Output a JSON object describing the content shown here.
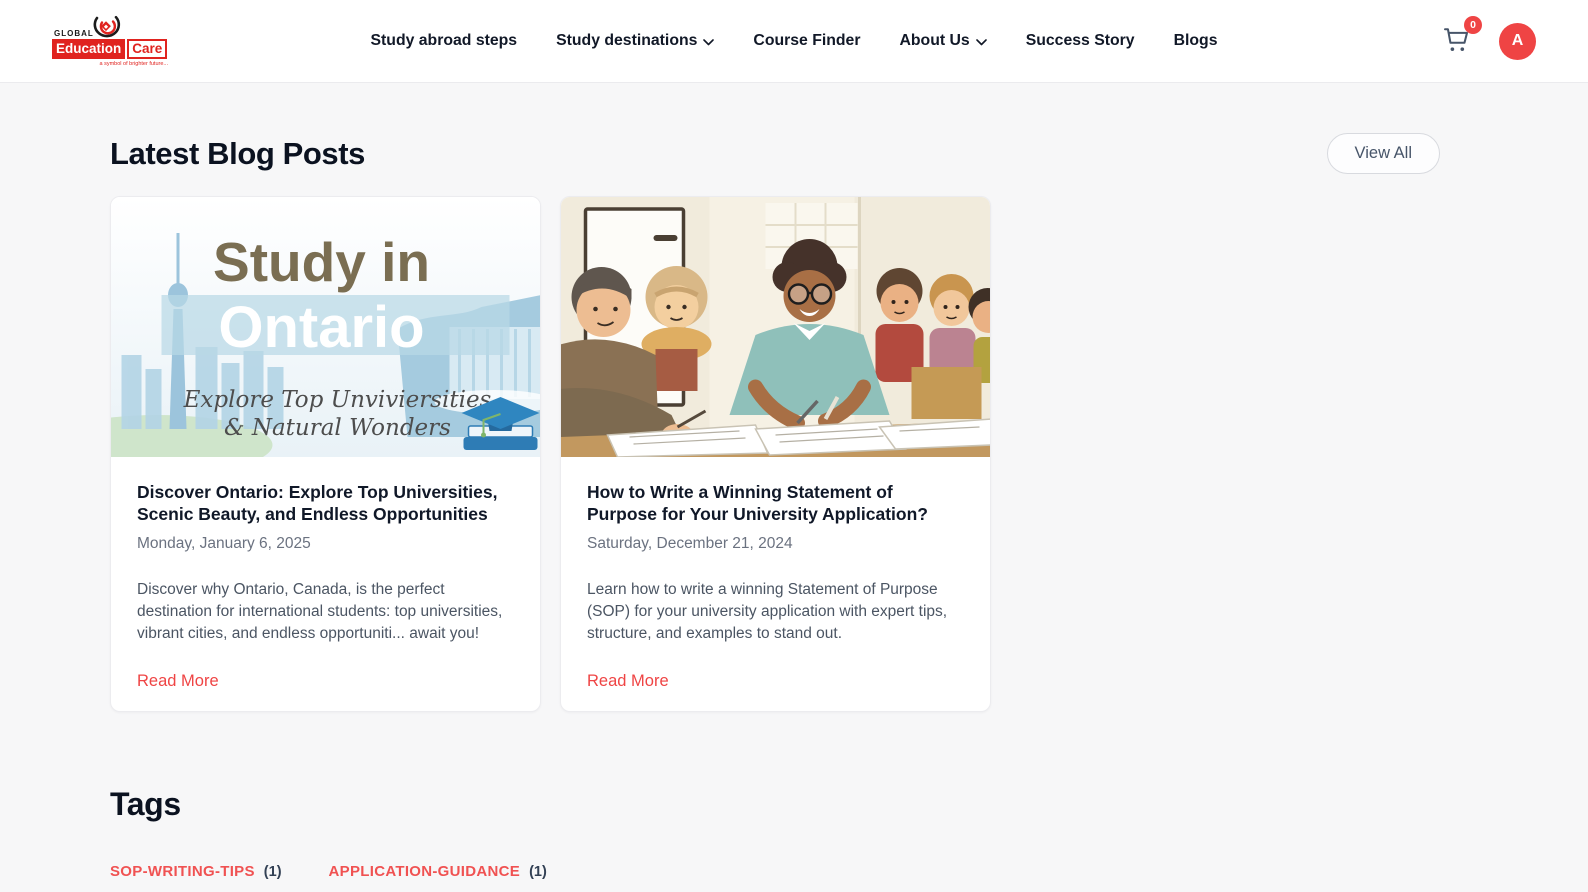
{
  "colors": {
    "accent_red": "#ef4444",
    "logo_red": "#e0231f",
    "tag_red": "#f05252",
    "page_bg": "#f7f7f8",
    "card_bg": "#ffffff",
    "nav_text": "#111827",
    "muted_text": "#6b7280"
  },
  "header": {
    "logo": {
      "icon": "logo-swirl-icon",
      "global": "GLOBAL",
      "education": "Education",
      "care": "Care",
      "tagline": "a symbol of brighter future..."
    },
    "nav": [
      {
        "label": "Study abroad steps",
        "dropdown": false
      },
      {
        "label": "Study destinations",
        "dropdown": true
      },
      {
        "label": "Course Finder",
        "dropdown": false
      },
      {
        "label": "About Us",
        "dropdown": true
      },
      {
        "label": "Success Story",
        "dropdown": false
      },
      {
        "label": "Blogs",
        "dropdown": false
      }
    ],
    "cart": {
      "icon": "cart-icon",
      "badge_count": "0"
    },
    "avatar": {
      "initial": "A"
    }
  },
  "main": {
    "section_title": "Latest Blog Posts",
    "view_all_label": "View All",
    "posts": [
      {
        "title": "Discover Ontario: Explore Top Universities, Scenic Beauty, and Endless Opportunities",
        "date": "Monday, January 6, 2025",
        "excerpt": "Discover why Ontario, Canada, is the perfect destination for international students: top universities, vibrant cities, and endless opportuniti... await you!",
        "read_more_label": "Read More",
        "image_text": {
          "headline_1": "Study in",
          "headline_2": "Ontario",
          "subline_1": "Explore Top Unviviersities",
          "subline_2": "& Natural Wonders"
        }
      },
      {
        "title": "How to Write a Winning Statement of Purpose for Your University Application?",
        "date": "Saturday, December 21, 2024",
        "excerpt": "Learn how to write a winning Statement of Purpose (SOP) for your university application with expert tips, structure, and examples to stand out.",
        "read_more_label": "Read More"
      }
    ]
  },
  "tags": {
    "section_title": "Tags",
    "items": [
      {
        "label": "SOP-WRITING-TIPS",
        "count": "(1)"
      },
      {
        "label": "APPLICATION-GUIDANCE",
        "count": "(1)"
      }
    ]
  }
}
